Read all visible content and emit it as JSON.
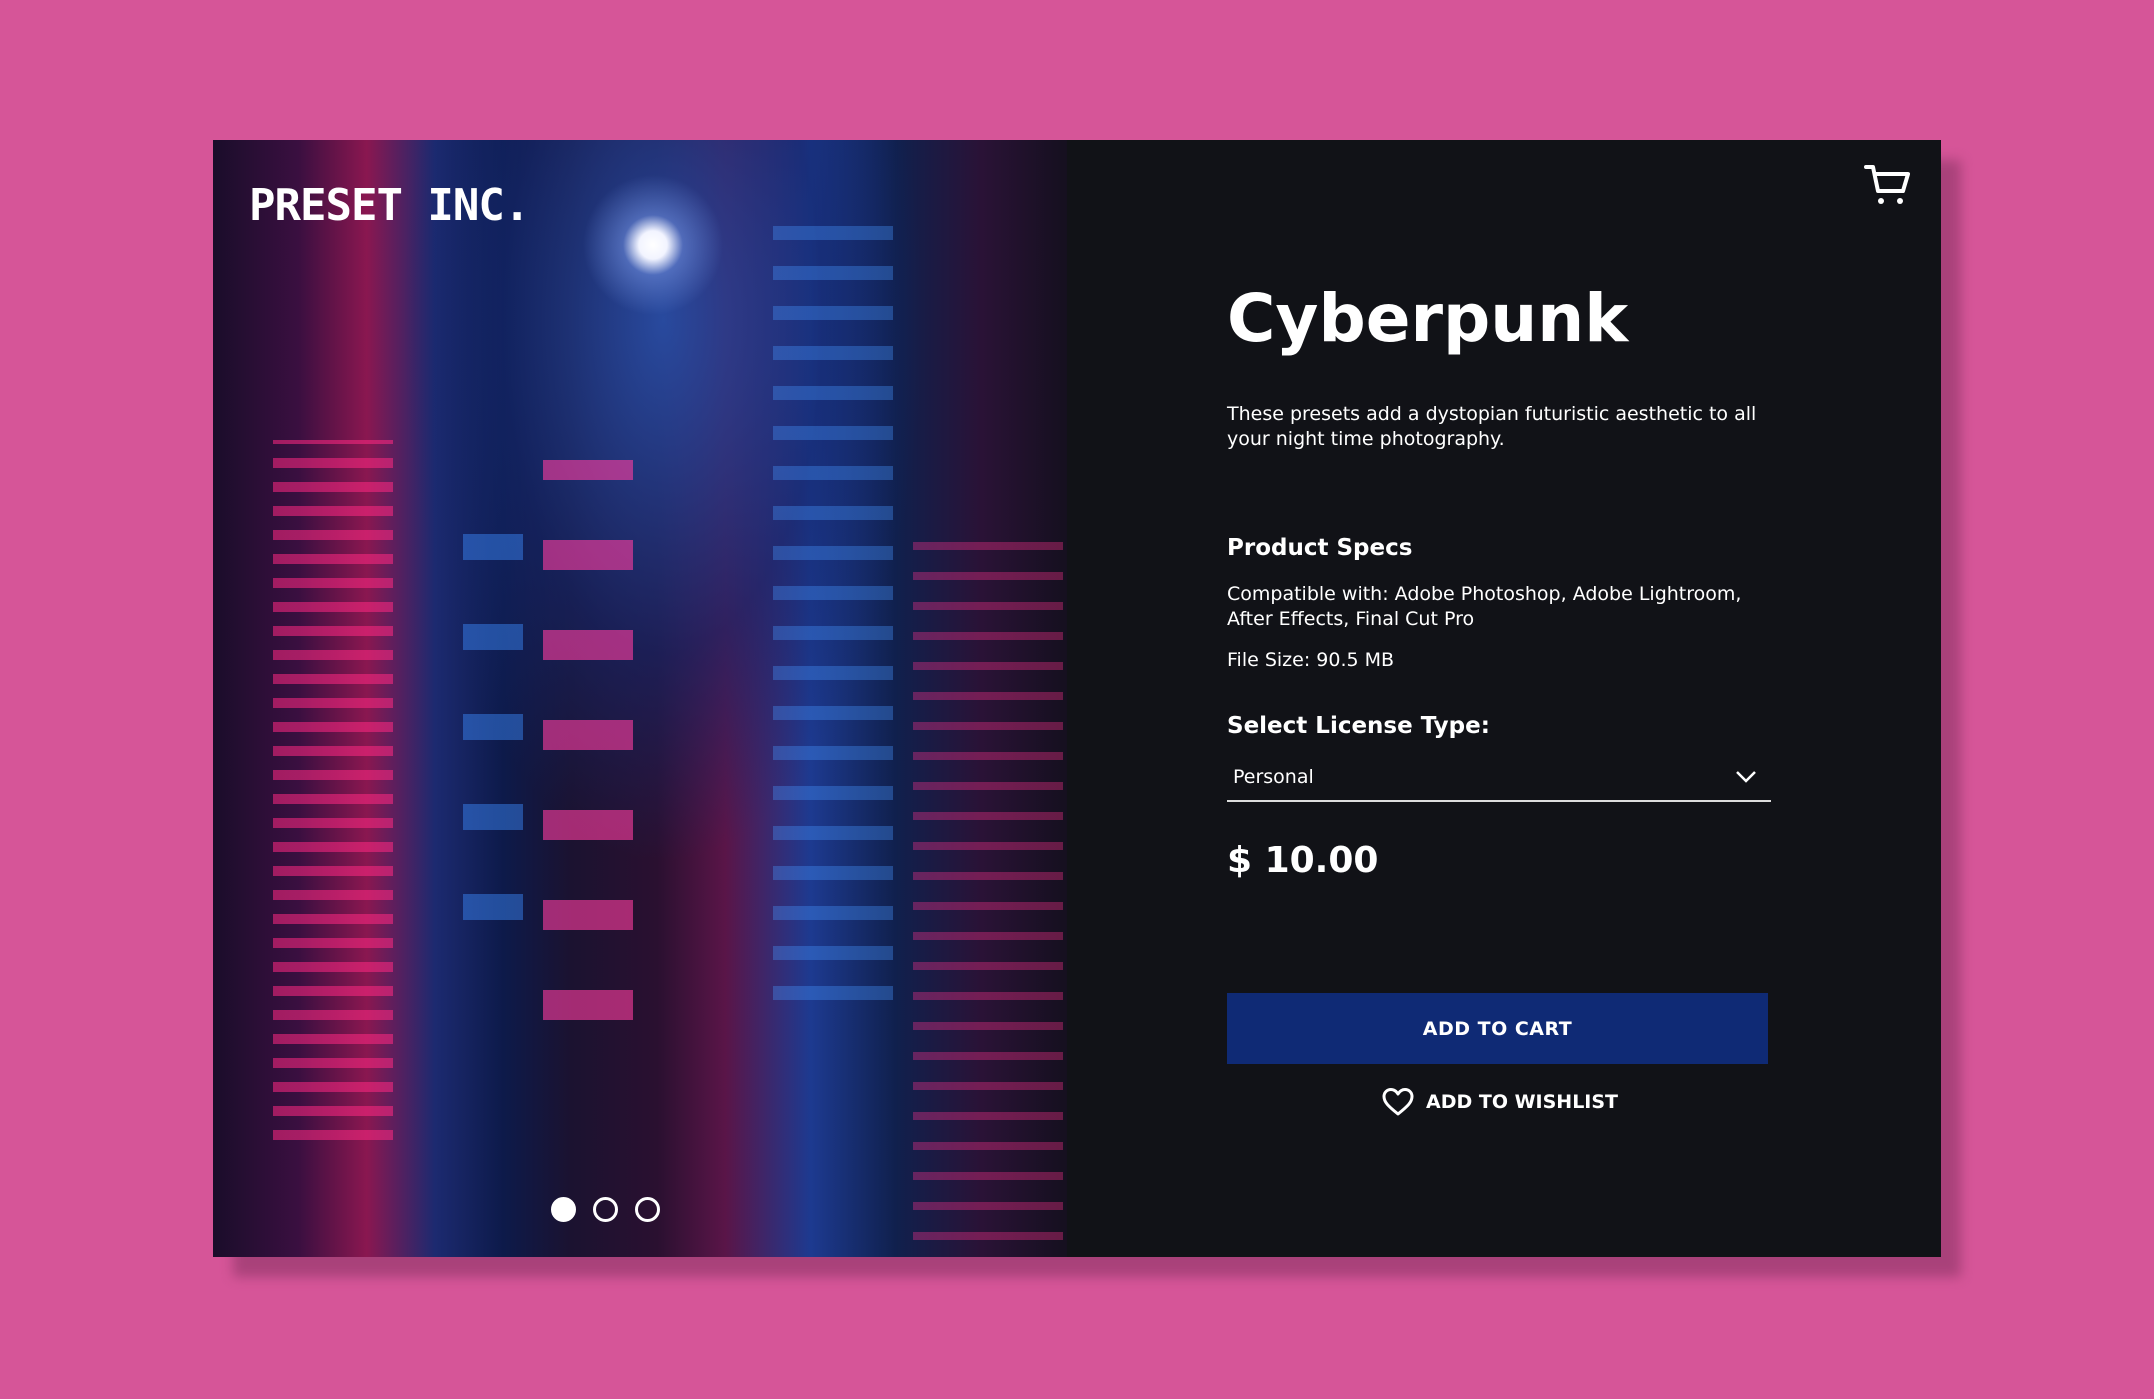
{
  "brand": {
    "logo": "PRESET INC."
  },
  "carousel": {
    "total": 3,
    "active": 0
  },
  "product": {
    "title": "Cyberpunk",
    "description": "These presets add a dystopian futuristic aesthetic to all your night time photography.",
    "specs_heading": "Product Specs",
    "compatible": "Compatible with: Adobe Photoshop, Adobe Lightroom, After Effects, Final Cut Pro",
    "file_size": "File Size: 90.5 MB",
    "license_label": "Select License Type:",
    "license_value": "Personal",
    "price": "$ 10.00"
  },
  "actions": {
    "add_to_cart": "ADD TO CART",
    "add_to_wishlist": "ADD TO WISHLIST"
  },
  "icons": {
    "cart": "cart-icon",
    "heart": "heart-icon",
    "chevron": "chevron-down-icon"
  },
  "colors": {
    "background": "#d65598",
    "panel": "#111217",
    "button": "#0f2a75"
  }
}
